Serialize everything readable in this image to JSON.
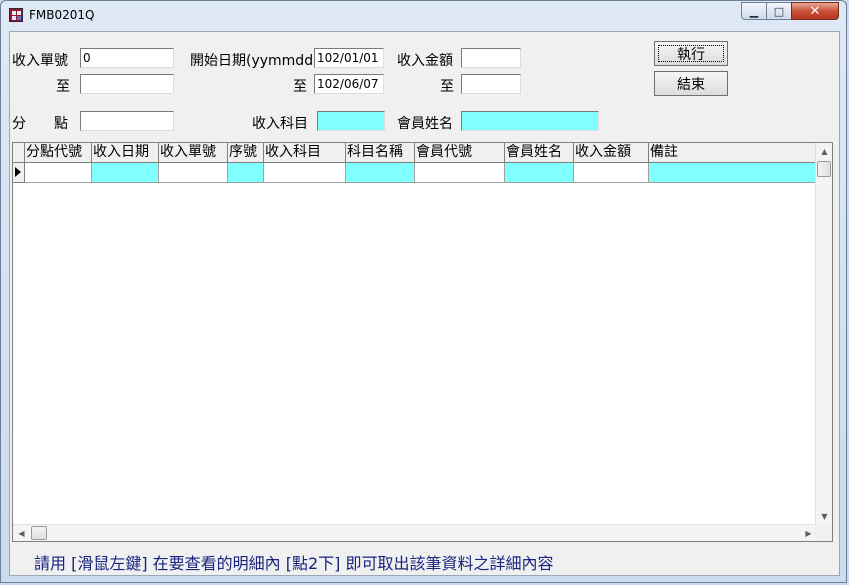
{
  "window": {
    "title": "FMB0201Q",
    "min_glyph": "▁",
    "max_glyph": "□",
    "close_glyph": "✕"
  },
  "form": {
    "receipt_no_label": "收入單號",
    "receipt_no_from": "0",
    "receipt_no_to": "",
    "to_label": "至",
    "start_date_label": "開始日期(yymmdd)",
    "start_date_from": "102/01/01",
    "start_date_to": "102/06/07",
    "amount_label": "收入金額",
    "amount_from": "",
    "amount_to": "",
    "branch_label": "分　　點",
    "branch_value": "",
    "subject_label": "收入科目",
    "subject_value": "",
    "member_name_label": "會員姓名",
    "member_name_value": ""
  },
  "buttons": {
    "execute": "執行",
    "exit": "結束"
  },
  "grid": {
    "columns": [
      "分點代號",
      "收入日期",
      "收入單號",
      "序號",
      "收入科目",
      "科目名稱",
      "會員代號",
      "會員姓名",
      "收入金額",
      "備註"
    ],
    "scroll_up": "▲",
    "scroll_down": "▼",
    "scroll_left": "◀",
    "scroll_right": "▶"
  },
  "status_text": "請用 [滑鼠左鍵]  在要查看的明細內 [點2下]  即可取出該筆資料之詳細內容"
}
